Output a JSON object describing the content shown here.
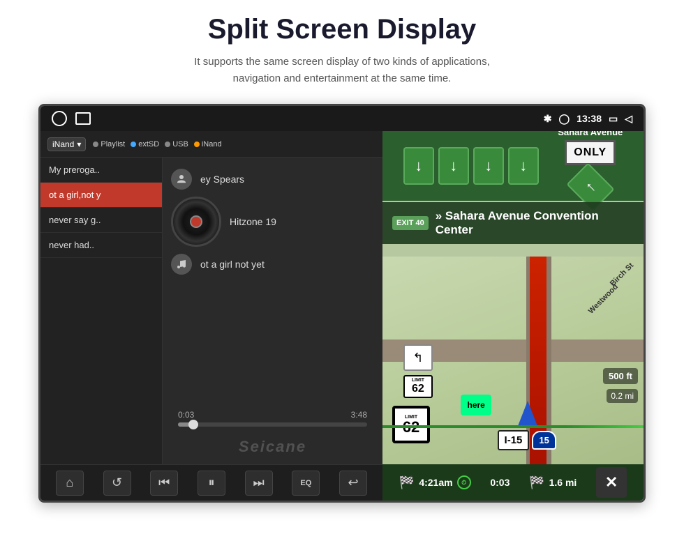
{
  "header": {
    "title": "Split Screen Display",
    "subtitle": "It supports the same screen display of two kinds of applications,\nnavigation and entertainment at the same time."
  },
  "statusbar": {
    "time": "13:38",
    "icons_right": [
      "bluetooth",
      "location",
      "time",
      "screen",
      "back"
    ]
  },
  "music_player": {
    "source_dropdown": "iNand",
    "source_options": [
      "Playlist",
      "extSD",
      "USB",
      "iNand"
    ],
    "playlist": [
      {
        "label": "My preroga..",
        "active": false
      },
      {
        "label": "ot a girl,not y",
        "active": true
      },
      {
        "label": "never say g..",
        "active": false
      },
      {
        "label": "never had..",
        "active": false
      }
    ],
    "track_artist": "ey Spears",
    "track_album": "Hitzone 19",
    "track_song": "ot a girl not yet",
    "progress_current": "0:03",
    "progress_total": "3:48",
    "watermark": "Seicane",
    "controls": [
      "home",
      "repeat",
      "prev",
      "pause",
      "next",
      "eq",
      "back"
    ]
  },
  "navigation": {
    "exit_number": "EXIT 40",
    "exit_destination": "» Sahara Avenue Convention Center",
    "highway": "I-15",
    "speed": "62",
    "speed_label": "62",
    "distance_to_turn": "0.2 mi",
    "distance_remaining": "500 ft",
    "eta_time": "4:21am",
    "eta_duration": "0:03",
    "eta_distance": "1.6 mi",
    "street_labels": [
      "Birch St",
      "Westwood"
    ],
    "only_label": "ONLY",
    "close_label": "✕"
  }
}
